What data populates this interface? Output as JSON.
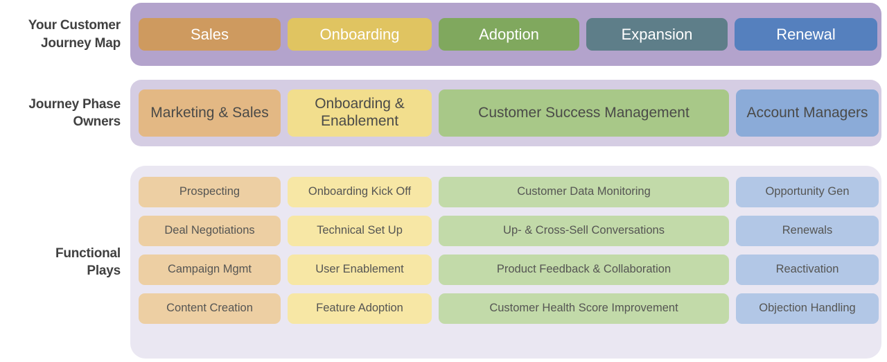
{
  "palette": {
    "band_primary": "#b3a3cc",
    "band_secondary": "#d5cde3",
    "band_tertiary": "#eae7f2",
    "orange_strong": "#ce9a5f",
    "yellow_strong": "#e0c461",
    "green_strong": "#80a85e",
    "teal_strong": "#5e7e89",
    "blue_strong": "#5580be",
    "orange_mid": "#e3b884",
    "yellow_mid": "#f2de8d",
    "green_mid": "#a8c888",
    "blue_mid": "#8babd8",
    "orange_light": "#edcfa3",
    "yellow_light": "#f7e7a5",
    "green_light": "#c2daa9",
    "blue_light": "#b2c7e6",
    "text_dark": "#404040",
    "text_cell": "#555553",
    "text_on_color": "#ffffff"
  },
  "sections": [
    {
      "label_lines": [
        "Your Customer",
        "Journey Map"
      ],
      "cells": [
        {
          "label": "Sales",
          "color": "#ce9a5f"
        },
        {
          "label": "Onboarding",
          "color": "#e0c461"
        },
        {
          "label": "Adoption",
          "color": "#80a85e"
        },
        {
          "label": "Expansion",
          "color": "#5e7e89"
        },
        {
          "label": "Renewal",
          "color": "#5580be"
        }
      ]
    },
    {
      "label_lines": [
        "Journey Phase",
        "Owners"
      ],
      "cells": [
        {
          "label": "Marketing & Sales",
          "color": "#e3b884"
        },
        {
          "label": "Onboarding & Enablement",
          "color": "#f2de8d"
        },
        {
          "label": "Customer Success Management",
          "color": "#a8c888"
        },
        {
          "label": "Account Managers",
          "color": "#8babd8"
        }
      ]
    },
    {
      "label_lines": [
        "Functional",
        "Plays"
      ],
      "rows": [
        [
          {
            "label": "Prospecting",
            "color": "#edcfa3"
          },
          {
            "label": "Onboarding Kick Off",
            "color": "#f7e7a5"
          },
          {
            "label": "Customer Data Monitoring",
            "color": "#c2daa9"
          },
          {
            "label": "Opportunity Gen",
            "color": "#b2c7e6"
          }
        ],
        [
          {
            "label": "Deal Negotiations",
            "color": "#edcfa3"
          },
          {
            "label": "Technical Set Up",
            "color": "#f7e7a5"
          },
          {
            "label": "Up- & Cross-Sell Conversations",
            "color": "#c2daa9"
          },
          {
            "label": "Renewals",
            "color": "#b2c7e6"
          }
        ],
        [
          {
            "label": "Campaign Mgmt",
            "color": "#edcfa3"
          },
          {
            "label": "User Enablement",
            "color": "#f7e7a5"
          },
          {
            "label": "Product Feedback & Collaboration",
            "color": "#c2daa9"
          },
          {
            "label": "Reactivation",
            "color": "#b2c7e6"
          }
        ],
        [
          {
            "label": "Content Creation",
            "color": "#edcfa3"
          },
          {
            "label": "Feature Adoption",
            "color": "#f7e7a5"
          },
          {
            "label": "Customer Health Score Improvement",
            "color": "#c2daa9"
          },
          {
            "label": "Objection Handling",
            "color": "#b2c7e6"
          }
        ]
      ]
    }
  ]
}
